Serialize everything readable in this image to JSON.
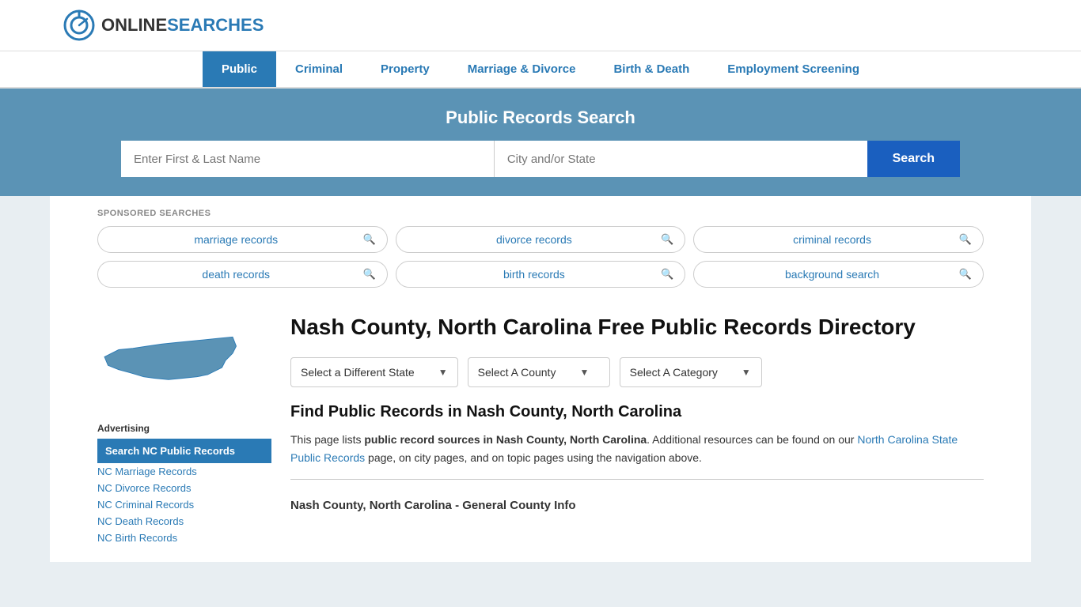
{
  "header": {
    "logo_text_online": "ONLINE",
    "logo_text_searches": "SEARCHES"
  },
  "nav": {
    "items": [
      {
        "label": "Public",
        "active": true
      },
      {
        "label": "Criminal",
        "active": false
      },
      {
        "label": "Property",
        "active": false
      },
      {
        "label": "Marriage & Divorce",
        "active": false
      },
      {
        "label": "Birth & Death",
        "active": false
      },
      {
        "label": "Employment Screening",
        "active": false
      }
    ]
  },
  "search_banner": {
    "title": "Public Records Search",
    "name_placeholder": "Enter First & Last Name",
    "location_placeholder": "City and/or State",
    "button_label": "Search"
  },
  "sponsored": {
    "label": "SPONSORED SEARCHES",
    "pills": [
      {
        "text": "marriage records"
      },
      {
        "text": "divorce records"
      },
      {
        "text": "criminal records"
      },
      {
        "text": "death records"
      },
      {
        "text": "birth records"
      },
      {
        "text": "background search"
      }
    ]
  },
  "sidebar": {
    "advertising_label": "Advertising",
    "highlighted_link": "Search NC Public Records",
    "links": [
      "NC Marriage Records",
      "NC Divorce Records",
      "NC Criminal Records",
      "NC Death Records",
      "NC Birth Records"
    ]
  },
  "article": {
    "title": "Nash County, North Carolina Free Public Records Directory",
    "dropdowns": {
      "state": "Select a Different State",
      "county": "Select A County",
      "category": "Select A Category"
    },
    "find_heading": "Find Public Records in Nash County, North Carolina",
    "find_body_1": "This page lists ",
    "find_body_bold": "public record sources in Nash County, North Carolina",
    "find_body_2": ". Additional resources can be found on our ",
    "find_link_text": "North Carolina State Public Records",
    "find_body_3": " page, on city pages, and on topic pages using the navigation above.",
    "county_info_heading": "Nash County, North Carolina - General County Info"
  }
}
